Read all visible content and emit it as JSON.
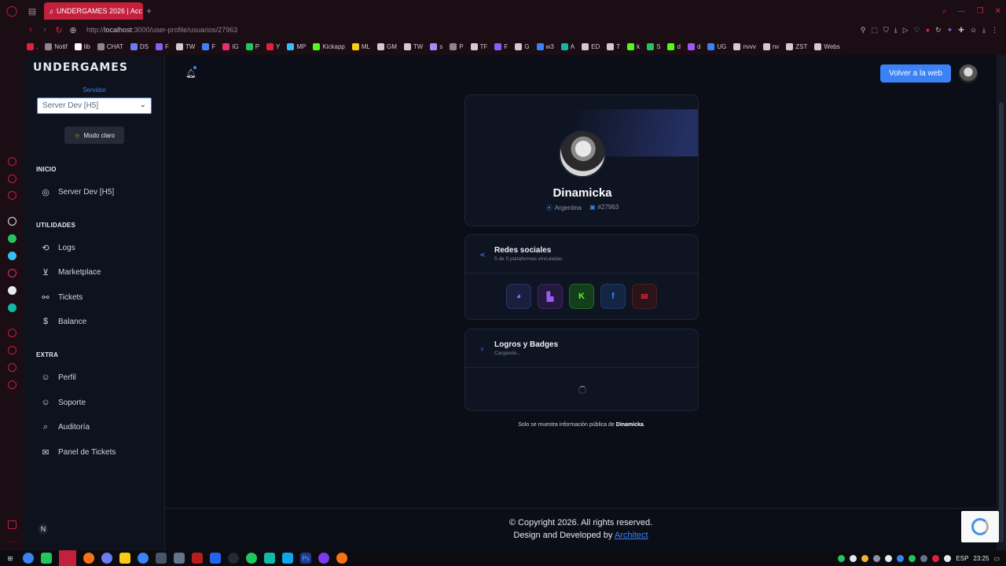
{
  "browser": {
    "tab_title": "UNDERGAMES 2026 | Acc",
    "url_prefix": "http://",
    "url_host": "localhost",
    "url_rest": ":3000/user-profile/usuarios/27963",
    "bookmarks": [
      {
        "label": ".",
        "color": "#e0213c"
      },
      {
        "label": "Notif",
        "color": "#8e8591"
      },
      {
        "label": "lib",
        "color": "#ffffff"
      },
      {
        "label": "CHAT",
        "color": "#8e8591"
      },
      {
        "label": "DS",
        "color": "#6c7df2"
      },
      {
        "label": "F",
        "color": "#8b5cf6"
      },
      {
        "label": "TW",
        "color": "#d2cad0"
      },
      {
        "label": "F",
        "color": "#3b82f6"
      },
      {
        "label": "IG",
        "color": "#e1306c"
      },
      {
        "label": "P",
        "color": "#22c55e"
      },
      {
        "label": "Y",
        "color": "#e0213c"
      },
      {
        "label": "MP",
        "color": "#38bdf8"
      },
      {
        "label": "Kickapp",
        "color": "#53fc18"
      },
      {
        "label": "ML",
        "color": "#facc15"
      },
      {
        "label": "GM",
        "color": "#d2cad0"
      },
      {
        "label": "TW",
        "color": "#d2cad0"
      },
      {
        "label": "s",
        "color": "#a78bfa"
      },
      {
        "label": "P",
        "color": "#8e8591"
      },
      {
        "label": "TF",
        "color": "#d2cad0"
      },
      {
        "label": "F",
        "color": "#8b5cf6"
      },
      {
        "label": "G",
        "color": "#d2cad0"
      },
      {
        "label": "w3",
        "color": "#3b82f6"
      },
      {
        "label": "A",
        "color": "#14b8a6"
      },
      {
        "label": "ED",
        "color": "#d2cad0"
      },
      {
        "label": "T",
        "color": "#d2cad0"
      },
      {
        "label": "k",
        "color": "#53fc18"
      },
      {
        "label": "S",
        "color": "#22c55e"
      },
      {
        "label": "d",
        "color": "#53fc18"
      },
      {
        "label": "d",
        "color": "#9b5cf6"
      },
      {
        "label": "UG",
        "color": "#3b82f6"
      },
      {
        "label": "nvvv",
        "color": "#d2cad0"
      },
      {
        "label": "nv",
        "color": "#d2cad0"
      },
      {
        "label": "ZST",
        "color": "#d2cad0"
      },
      {
        "label": "Webs",
        "color": "#d2cad0"
      }
    ]
  },
  "sidebar": {
    "logo": "UNDERGAMES",
    "server_label": "Servidor",
    "server_value": "Server Dev [H5]",
    "mode_button": "Modo claro",
    "sections": {
      "inicio": "INICIO",
      "utilidades": "UTILIDADES",
      "extra": "EXTRA"
    },
    "items": {
      "server": "Server Dev [H5]",
      "logs": "Logs",
      "marketplace": "Marketplace",
      "tickets": "Tickets",
      "balance": "Balance",
      "perfil": "Perfil",
      "soporte": "Soporte",
      "auditoria": "Auditoría",
      "panel_tickets": "Panel de Tickets"
    }
  },
  "header": {
    "back_button": "Volver a la web"
  },
  "profile": {
    "username": "Dinamicka",
    "country": "Argentina",
    "id": "#27963"
  },
  "social": {
    "title": "Redes sociales",
    "subtitle": "5 de 5 plataformas vinculadas",
    "platforms": [
      "discord",
      "twitch",
      "kick",
      "facebook",
      "mail"
    ]
  },
  "badges": {
    "title": "Logros y Badges",
    "subtitle": "Cargando..."
  },
  "note": {
    "prefix": "Solo se muestra información pública de",
    "name": "Dinamicka",
    "suffix": "."
  },
  "footer": {
    "copyright": "© Copyright 2026. All rights reserved.",
    "design_prefix": "Design and Developed by",
    "design_link": "Architect"
  },
  "taskbar": {
    "language": "ESP",
    "time": "23:25"
  }
}
